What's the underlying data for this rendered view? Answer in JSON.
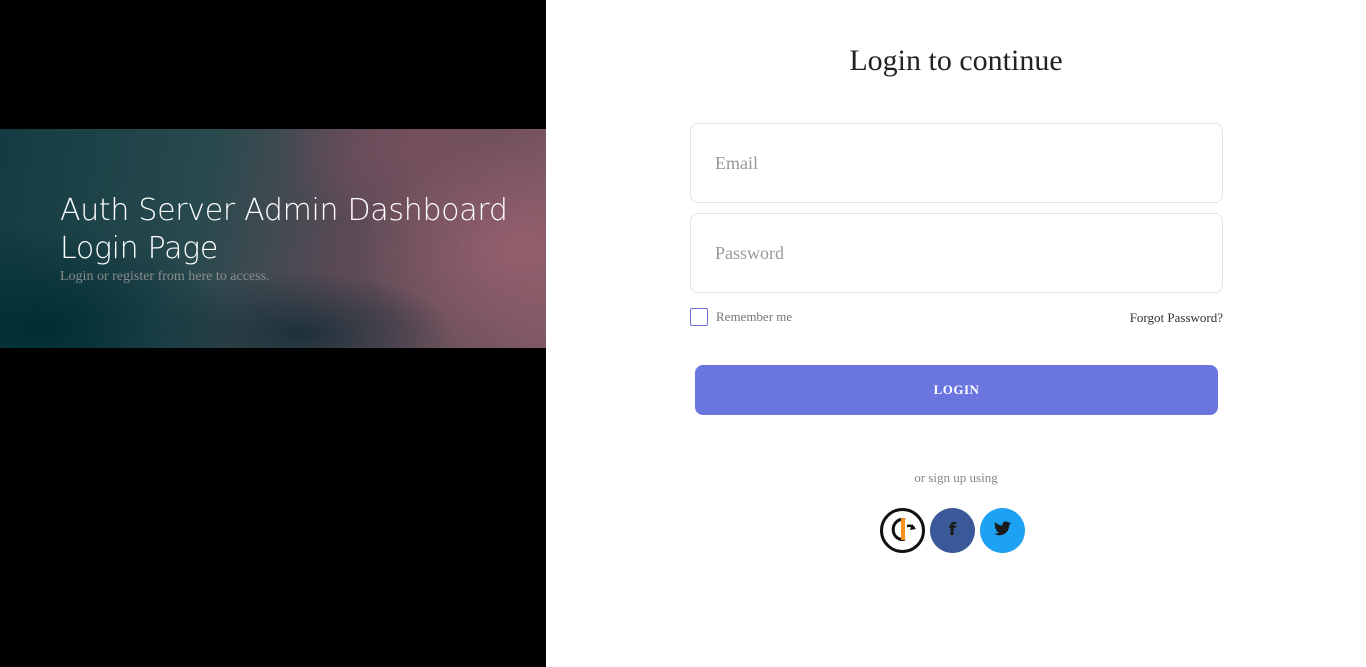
{
  "hero": {
    "title": "Auth Server Admin Dashboard Login Page",
    "subtitle": "Login or register from here to access."
  },
  "form": {
    "title": "Login to continue",
    "email_placeholder": "Email",
    "password_placeholder": "Password",
    "remember_label": "Remember me",
    "forgot_label": "Forgot Password?",
    "login_label": "LOGIN",
    "signup_text": "or sign up using"
  },
  "social": {
    "buttons": [
      {
        "name": "openid",
        "icon": "openid-icon",
        "color": "#ffffff"
      },
      {
        "name": "facebook",
        "icon": "facebook-icon",
        "glyph": "f",
        "color": "#3b5998"
      },
      {
        "name": "twitter",
        "icon": "twitter-icon",
        "color": "#1da1f2"
      }
    ]
  },
  "colors": {
    "accent": "#6a75e0",
    "left_background": "#000000"
  }
}
